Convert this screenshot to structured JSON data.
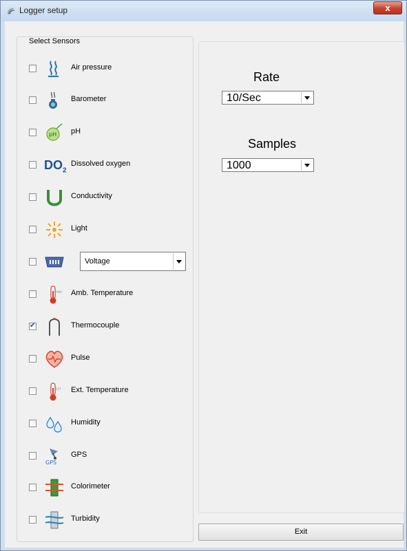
{
  "window": {
    "title": "Logger setup",
    "close_glyph": "x"
  },
  "sensors_group": {
    "label": "Select Sensors",
    "items": [
      {
        "label": "Air pressure",
        "checked": false,
        "icon": "air-pressure-icon"
      },
      {
        "label": "Barometer",
        "checked": false,
        "icon": "barometer-icon"
      },
      {
        "label": "pH",
        "checked": false,
        "icon": "ph-icon"
      },
      {
        "label": "Dissolved oxygen",
        "checked": false,
        "icon": "dissolved-oxygen-icon",
        "icon_text": "DO",
        "icon_sub": "2"
      },
      {
        "label": "Conductivity",
        "checked": false,
        "icon": "conductivity-icon"
      },
      {
        "label": "Light",
        "checked": false,
        "icon": "light-icon"
      },
      {
        "label": "Voltage",
        "checked": false,
        "icon": "voltage-icon",
        "is_select": true
      },
      {
        "label": "Amb. Temperature",
        "checked": false,
        "icon": "amb-temperature-icon"
      },
      {
        "label": "Thermocouple",
        "checked": true,
        "icon": "thermocouple-icon"
      },
      {
        "label": "Pulse",
        "checked": false,
        "icon": "pulse-icon"
      },
      {
        "label": "Ext. Temperature",
        "checked": false,
        "icon": "ext-temperature-icon"
      },
      {
        "label": "Humidity",
        "checked": false,
        "icon": "humidity-icon"
      },
      {
        "label": "GPS",
        "checked": false,
        "icon": "gps-icon",
        "icon_text": "GPS"
      },
      {
        "label": "Colorimeter",
        "checked": false,
        "icon": "colorimeter-icon"
      },
      {
        "label": "Turbidity",
        "checked": false,
        "icon": "turbidity-icon"
      }
    ]
  },
  "settings": {
    "rate_label": "Rate",
    "rate_value": "10/Sec",
    "samples_label": "Samples",
    "samples_value": "1000"
  },
  "exit_label": "Exit",
  "colors": {
    "titlebar": "#c6d9ee",
    "close_button": "#c7412c",
    "panel_background": "#f0f0f0",
    "check_mark": "#1c4ea8"
  }
}
